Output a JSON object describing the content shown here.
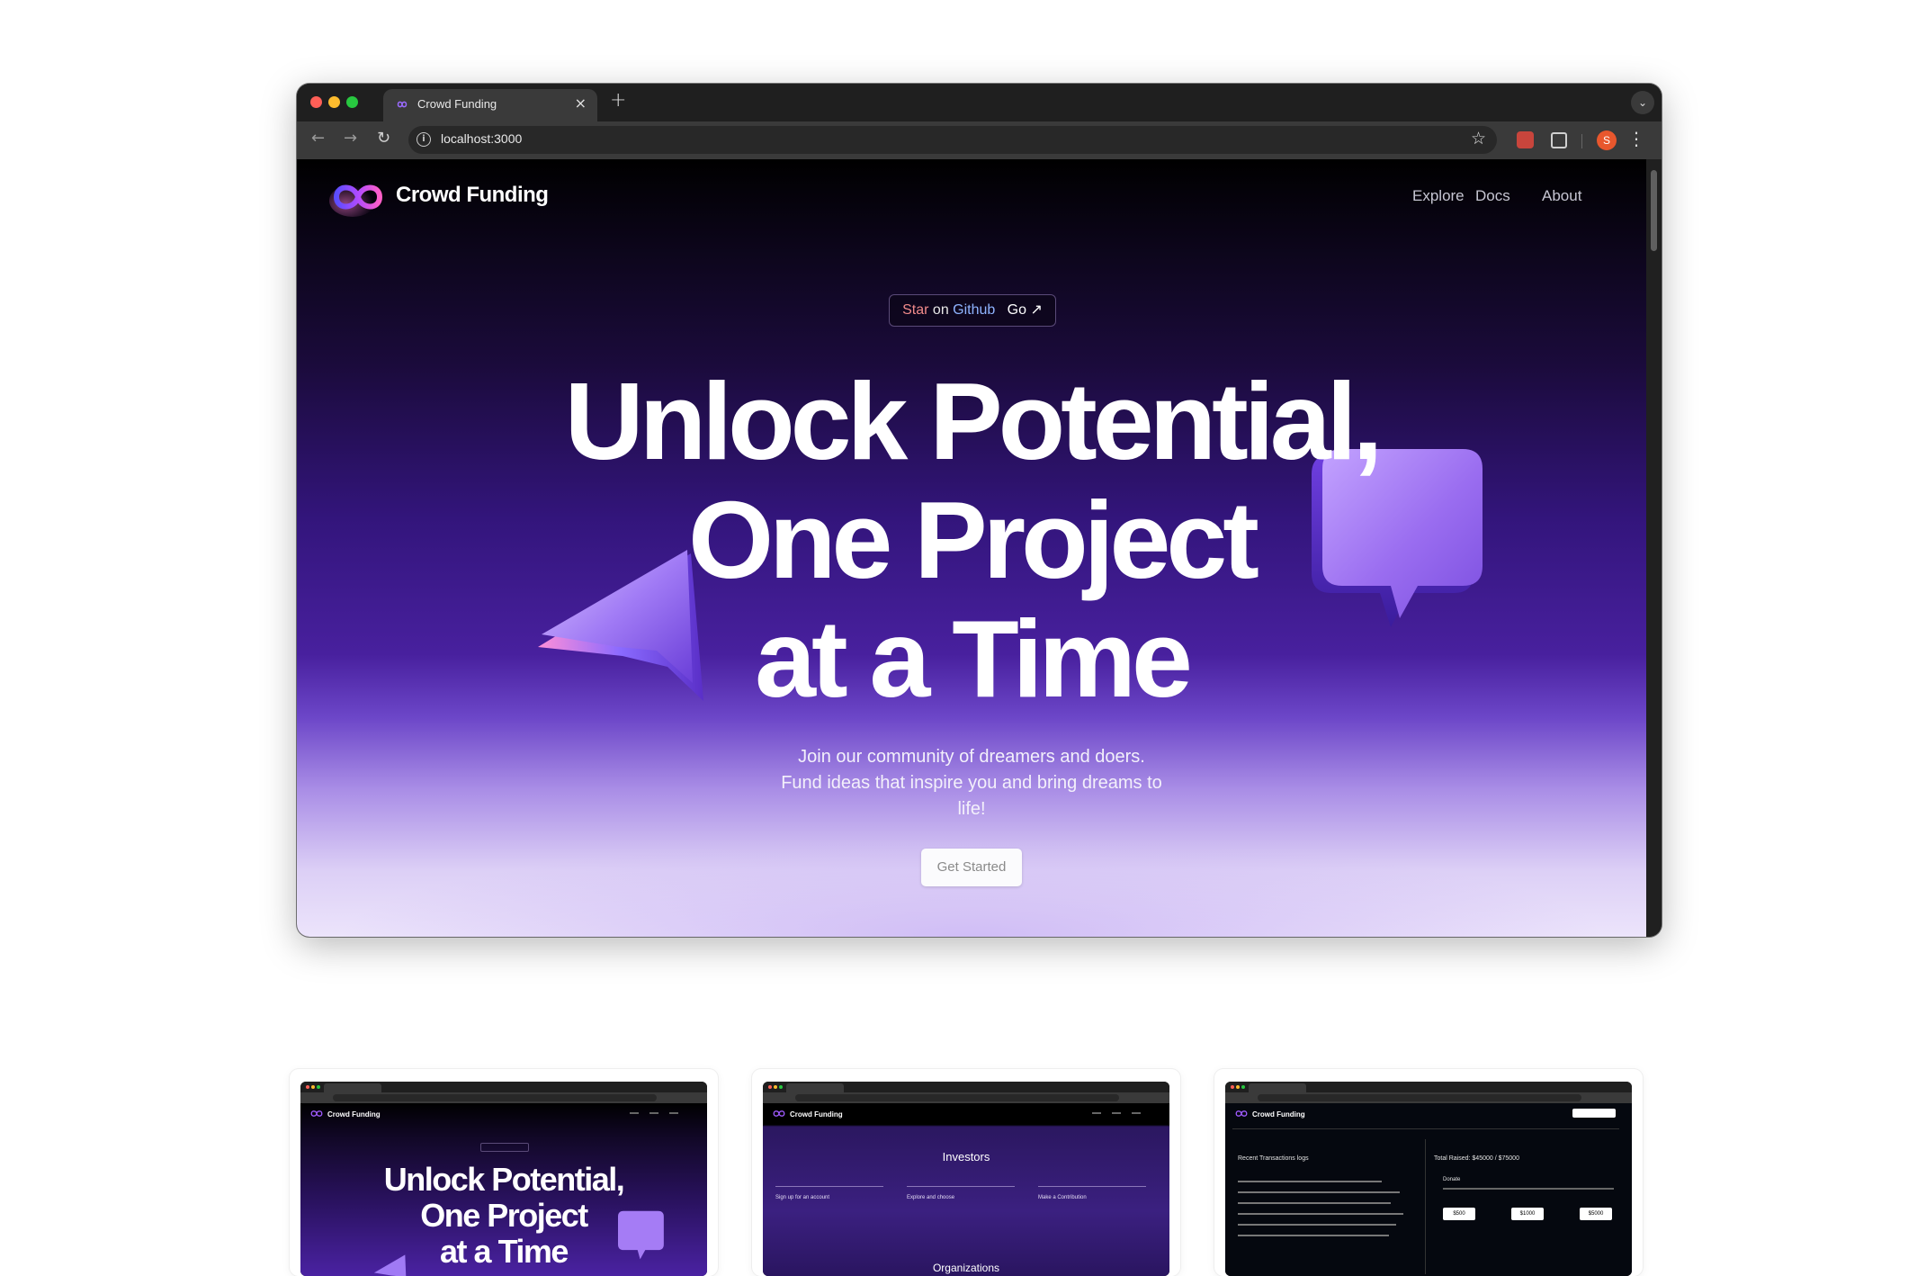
{
  "browser": {
    "tab_title": "Crowd Funding",
    "tab_close": "×",
    "new_tab": "+",
    "url": "localhost:3000",
    "profile_initial": "S"
  },
  "site": {
    "brand": "Crowd Funding",
    "nav": [
      "Explore",
      "Docs",
      "About"
    ],
    "github_badge": {
      "star": "Star",
      "on": "on",
      "github": "Github",
      "go": "Go ↗"
    },
    "hero_lines": [
      "Unlock Potential,",
      "One Project",
      "at a Time"
    ],
    "subtitle_lines": [
      "Join our community of dreamers and doers.",
      "Fund ideas that inspire you and bring dreams to",
      "life!"
    ],
    "cta": "Get Started"
  },
  "thumbnails": [
    {
      "brand": "Crowd Funding",
      "hero_lines": [
        "Unlock Potential,",
        "One Project",
        "at a Time"
      ]
    },
    {
      "brand": "Crowd Funding",
      "heading": "Investors",
      "columns": [
        "Sign up for an account",
        "Explore and choose",
        "Make a Contribution"
      ],
      "footer_heading": "Organizations"
    },
    {
      "brand": "Crowd Funding",
      "left_heading": "Recent Transactions logs",
      "right_heading": "Total Raised: $45000 / $75000",
      "donate_label": "Donate",
      "amounts": [
        "$500",
        "$1000",
        "$5000"
      ]
    }
  ],
  "colors": {
    "accent_purple": "#6c46c8",
    "github_star": "#f08a8a",
    "github_link": "#7fb0ff",
    "traffic_red": "#ff5f57",
    "traffic_yellow": "#febc2e",
    "traffic_green": "#28c840"
  },
  "icons": [
    "infinity-logo-icon",
    "back-arrow-icon",
    "forward-arrow-icon",
    "reload-icon",
    "site-info-icon",
    "bookmark-star-icon",
    "extension-icon",
    "puzzle-icon",
    "kebab-menu-icon",
    "paper-plane-cursor-3d",
    "speech-bubble-3d"
  ]
}
